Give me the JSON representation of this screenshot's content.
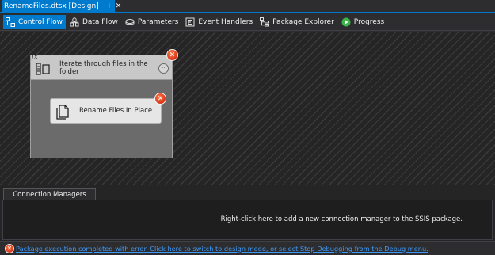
{
  "document_tab": {
    "title": "RenameFiles.dtsx [Design]",
    "pin_glyph": "⊣",
    "close_glyph": "✕"
  },
  "toolbar": {
    "items": [
      {
        "label": "Control Flow",
        "icon": "control-flow-icon",
        "active": true
      },
      {
        "label": "Data Flow",
        "icon": "data-flow-icon",
        "active": false
      },
      {
        "label": "Parameters",
        "icon": "parameters-icon",
        "active": false
      },
      {
        "label": "Event Handlers",
        "icon": "event-handlers-icon",
        "active": false
      },
      {
        "label": "Package Explorer",
        "icon": "package-explorer-icon",
        "active": false
      },
      {
        "label": "Progress",
        "icon": "progress-icon",
        "active": false
      }
    ]
  },
  "canvas": {
    "container": {
      "title": "Iterate through files in the folder",
      "fx": "fx",
      "collapse_glyph": "⌃",
      "error_glyph": "✕"
    },
    "task": {
      "label": "Rename Files In Place",
      "error_glyph": "✕"
    }
  },
  "connection_managers": {
    "tab_label": "Connection Managers",
    "hint": "Right-click here to add a new connection manager to the SSIS package."
  },
  "status": {
    "error_glyph": "✕",
    "message": "Package execution completed with error. Click here to switch to design mode, or select Stop Debugging from the Debug menu."
  },
  "colors": {
    "accent": "#007acc",
    "error": "#d8341a",
    "link": "#3e9bfa"
  }
}
